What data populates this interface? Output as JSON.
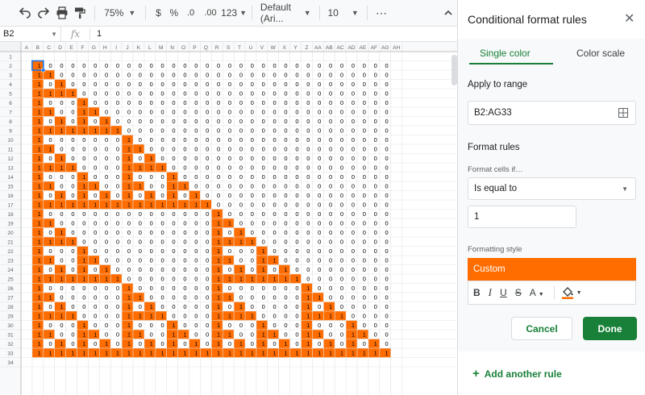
{
  "toolbar": {
    "zoom": "75%",
    "currency": "$",
    "percent": "%",
    "dec_decrease": ".0",
    "dec_increase": ".00",
    "number_format": "123",
    "font": "Default (Ari...",
    "font_size": "10",
    "more": "⋯"
  },
  "formula_bar": {
    "cell_ref": "B2",
    "fx": "fx",
    "value": "1"
  },
  "grid": {
    "columns": [
      "A",
      "B",
      "C",
      "D",
      "E",
      "F",
      "G",
      "H",
      "I",
      "J",
      "K",
      "L",
      "M",
      "N",
      "O",
      "P",
      "Q",
      "R",
      "S",
      "T",
      "U",
      "V",
      "W",
      "X",
      "Y",
      "Z",
      "AA",
      "AB",
      "AC",
      "AD",
      "AE",
      "AF",
      "AG",
      "AH"
    ],
    "rows": [
      "1",
      "2",
      "3",
      "4",
      "5",
      "6",
      "7",
      "8",
      "9",
      "10",
      "11",
      "12",
      "13",
      "14",
      "15",
      "16",
      "17",
      "18",
      "19",
      "20",
      "21",
      "22",
      "23",
      "24",
      "25",
      "26",
      "27",
      "28",
      "29",
      "30",
      "31",
      "32",
      "33",
      "34"
    ],
    "range_rows": 32,
    "range_cols": 32,
    "highlight_color": "#ff6d01",
    "highlight_value": "1",
    "blank_value": "0",
    "selection_color": "#1a73e8"
  },
  "panel": {
    "title": "Conditional format rules",
    "close": "✕",
    "tabs": [
      "Single color",
      "Color scale"
    ],
    "apply_label": "Apply to range",
    "range_value": "B2:AG33",
    "format_rules_label": "Format rules",
    "format_cells_if": "Format cells if…",
    "condition": "Is equal to",
    "condition_value": "1",
    "formatting_style_label": "Formatting style",
    "style_name": "Custom",
    "style_buttons": [
      "B",
      "I",
      "U",
      "S",
      "A"
    ],
    "cancel": "Cancel",
    "done": "Done",
    "add_rule": "Add another rule",
    "accent": "#188038"
  }
}
